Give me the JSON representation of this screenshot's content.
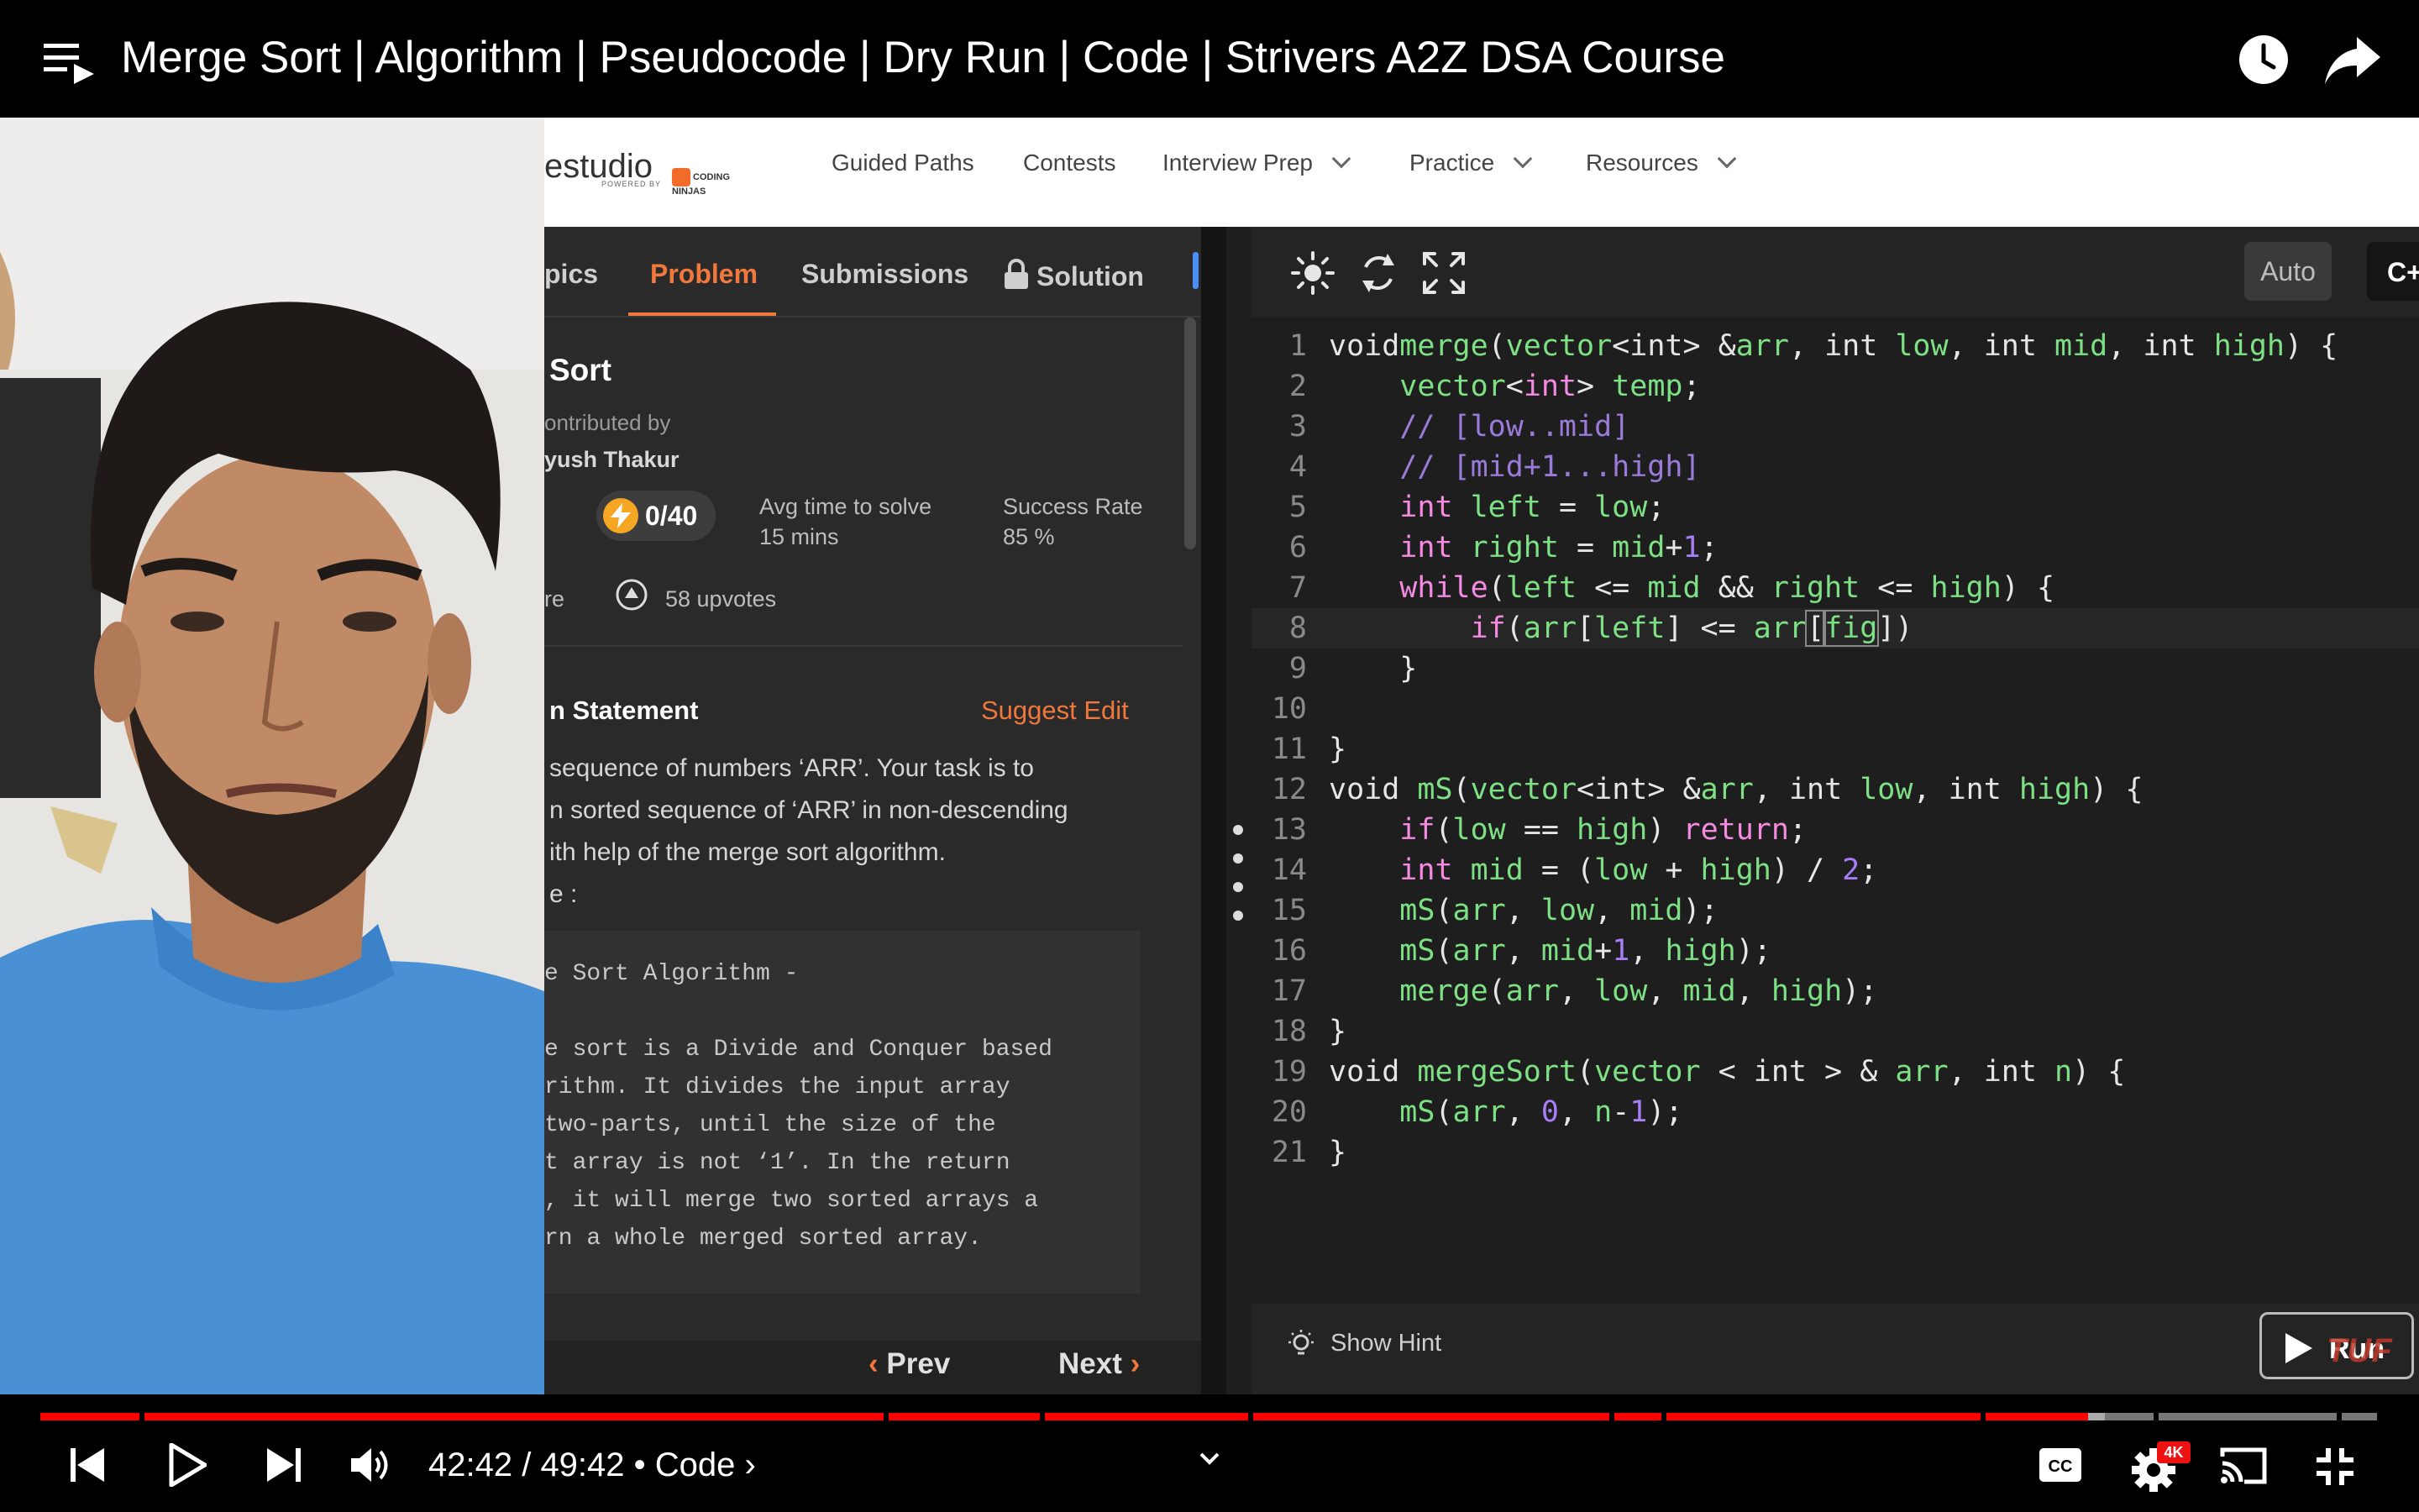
{
  "player": {
    "title": "Merge Sort | Algorithm | Pseudocode | Dry Run | Code | Strivers A2Z DSA Course",
    "time": "42:42 / 49:42",
    "chapter": "• Code ›",
    "progress_fraction": 0.86,
    "icons": [
      "playlist-icon",
      "watch-later-icon",
      "share-icon",
      "previous-icon",
      "play-icon",
      "next-icon",
      "volume-icon",
      "captions-icon",
      "settings-icon",
      "cast-icon",
      "exit-fullscreen-icon"
    ],
    "quality_badge": "4K"
  },
  "site": {
    "logo": "estudio",
    "logo_sub": "POWERED BY",
    "partner": "CODING NINJAS",
    "nav": [
      "Guided Paths",
      "Contests",
      "Interview Prep",
      "Practice",
      "Resources"
    ]
  },
  "problem": {
    "tabs": [
      "pics",
      "Problem",
      "Submissions",
      "Solution"
    ],
    "active_tab": "Problem",
    "title": "Sort",
    "contributed_label": "ontributed by",
    "author": "yush Thakur",
    "score": "0/40",
    "avg_label": "Avg time to solve",
    "avg_value": "15 mins",
    "success_label": "Success Rate",
    "success_value": "85 %",
    "share_frag": "re",
    "upvotes": "58 upvotes",
    "statement_title": "n Statement",
    "suggest_edit": "Suggest Edit",
    "statement_lines": [
      "sequence of numbers ‘ARR’. Your task is to",
      "n sorted sequence of ‘ARR’ in non-descending",
      "ith help of the merge sort algorithm.",
      "e :"
    ],
    "algo_lines": [
      "e Sort Algorithm -",
      "",
      "e sort is a Divide and Conquer based",
      "rithm. It divides the input array",
      " two-parts, until the size of the",
      "t array is not ‘1’. In the return",
      ", it will merge two sorted arrays a",
      "rn a whole merged sorted array."
    ],
    "prev": "Prev",
    "next": "Next"
  },
  "editor": {
    "auto_label": "Auto",
    "lang_label": "C++ (g",
    "hint_label": "Show Hint",
    "run_label": "Run",
    "watermark": "TUF",
    "line_numbers": [
      "1",
      "2",
      "3",
      "4",
      "5",
      "6",
      "7",
      "8",
      "9",
      "10",
      "11",
      "12",
      "13",
      "14",
      "15",
      "16",
      "17",
      "18",
      "19",
      "20",
      "21"
    ],
    "code": {
      "l1": [
        "void",
        "merge",
        "(",
        "vector",
        "<",
        "int",
        "> &",
        "arr",
        ", ",
        "int",
        " ",
        "low",
        ", ",
        "int",
        " ",
        "mid",
        ", ",
        "int",
        " ",
        "high",
        ") {"
      ],
      "l2": [
        "    ",
        "vector",
        "<",
        "int",
        "> ",
        "temp",
        ";"
      ],
      "l3": [
        "    // [low..mid]"
      ],
      "l4": [
        "    // [mid+1...high]"
      ],
      "l5": [
        "    ",
        "int",
        " ",
        "left",
        " = ",
        "low",
        ";"
      ],
      "l6": [
        "    ",
        "int",
        " ",
        "right",
        " = ",
        "mid",
        "+",
        "1",
        ";"
      ],
      "l7": [
        "    ",
        "while",
        "(",
        "left",
        " <= ",
        "mid",
        " && ",
        "right",
        " <= ",
        "high",
        ") {"
      ],
      "l8": [
        "        ",
        "if",
        "(",
        "arr",
        "[",
        "left",
        "] <= ",
        "arr",
        "[",
        "fig",
        "]",
        ")"
      ],
      "l9": [
        "    }"
      ],
      "l10": [
        ""
      ],
      "l11": [
        "}"
      ],
      "l12": [
        "void",
        " ",
        "mS",
        "(",
        "vector",
        "<",
        "int",
        "> &",
        "arr",
        ", ",
        "int",
        " ",
        "low",
        ", ",
        "int",
        " ",
        "high",
        ") {"
      ],
      "l13": [
        "    ",
        "if",
        "(",
        "low",
        " == ",
        "high",
        ") ",
        "return",
        ";"
      ],
      "l14": [
        "    ",
        "int",
        " ",
        "mid",
        " = (",
        "low",
        " + ",
        "high",
        ") / ",
        "2",
        ";"
      ],
      "l15": [
        "    ",
        "mS",
        "(",
        "arr",
        ", ",
        "low",
        ", ",
        "mid",
        ");"
      ],
      "l16": [
        "    ",
        "mS",
        "(",
        "arr",
        ", ",
        "mid",
        "+",
        "1",
        ", ",
        "high",
        ");"
      ],
      "l17": [
        "    ",
        "merge",
        "(",
        "arr",
        ", ",
        "low",
        ", ",
        "mid",
        ", ",
        "high",
        ");"
      ],
      "l18": [
        "}"
      ],
      "l19": [
        "void",
        " ",
        "mergeSort",
        "(",
        "vector",
        " < ",
        "int",
        " > & ",
        "arr",
        ", ",
        "int",
        " ",
        "n",
        ") {"
      ],
      "l20": [
        "    ",
        "mS",
        "(",
        "arr",
        ", ",
        "0",
        ", ",
        "n",
        "-",
        "1",
        ");"
      ],
      "l21": [
        "}"
      ]
    }
  },
  "colors": {
    "accent_orange": "#f0783c",
    "youtube_red": "#ff0000",
    "editor_bg": "#1e1e1e",
    "keyword": "#f58be0",
    "identifier": "#7ee085",
    "comment": "#9b7bd9"
  }
}
